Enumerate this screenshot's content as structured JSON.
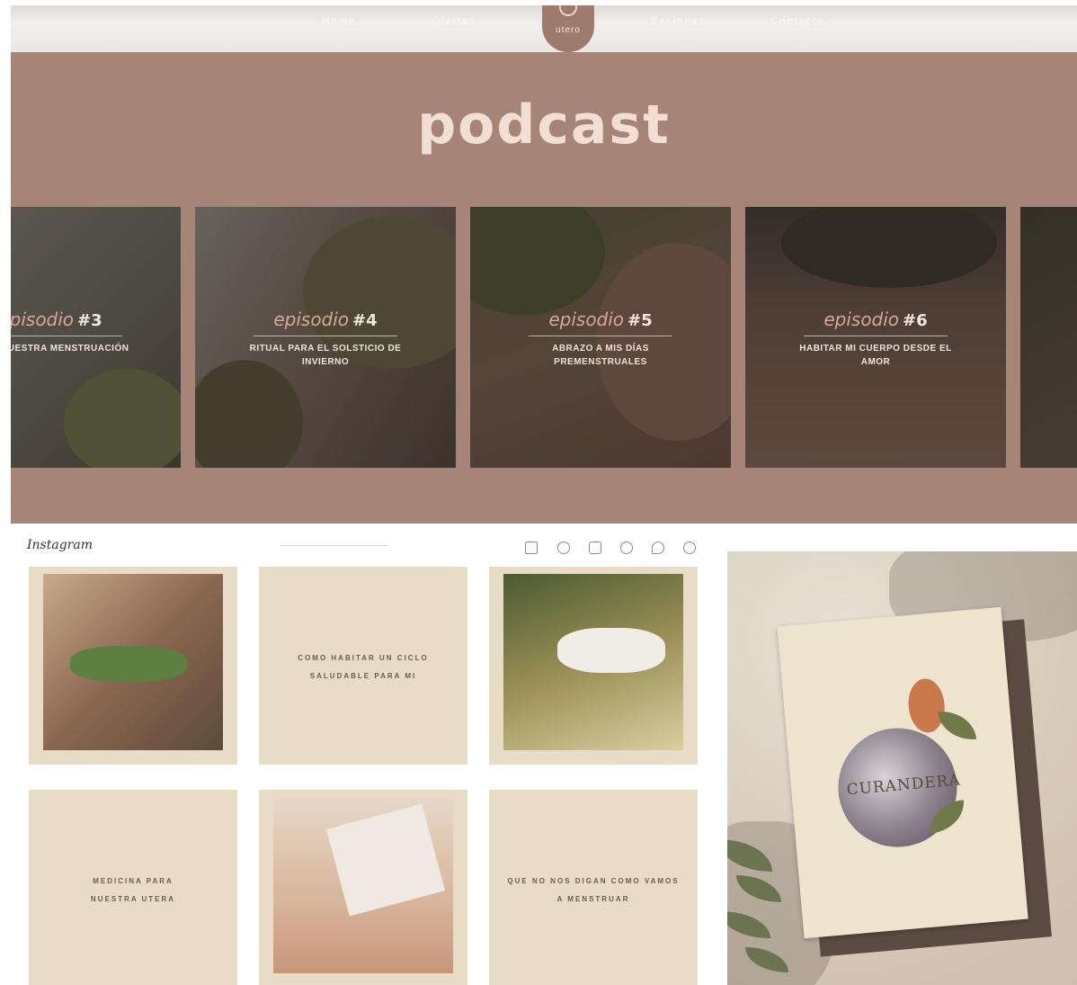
{
  "nav": {
    "links_left": [
      "Home",
      "Ofertas"
    ],
    "logo_text": "utero",
    "links_right": [
      "Sesiones",
      "Contacto"
    ]
  },
  "site": {
    "title": "podcast",
    "episode_word": "episodio",
    "episodes": [
      {
        "number": "#3",
        "title": "para nuestra menstruación"
      },
      {
        "number": "#4",
        "title": "Ritual para el solsticio de invierno"
      },
      {
        "number": "#5",
        "title": "Abrazo a mis días premenstruales"
      },
      {
        "number": "#6",
        "title": "Habitar mi cuerpo desde el amor"
      }
    ]
  },
  "instagram": {
    "logo": "Instagram",
    "quotes": [
      "COMO HABITAR UN CICLO SALUDABLE PARA MI",
      "MEDICINA PARA NUESTRA UTERA",
      "QUE NO NOS DIGAN COMO VAMOS A MENSTRUAR"
    ],
    "icons": [
      "home-icon",
      "messenger-icon",
      "explore-icon",
      "compass-icon",
      "heart-icon",
      "profile-icon"
    ]
  },
  "mockup": {
    "card_title": "CURANDERA"
  },
  "colors": {
    "brand": "#a78478",
    "accent": "#d8a896",
    "tile": "#e9dcc7"
  }
}
